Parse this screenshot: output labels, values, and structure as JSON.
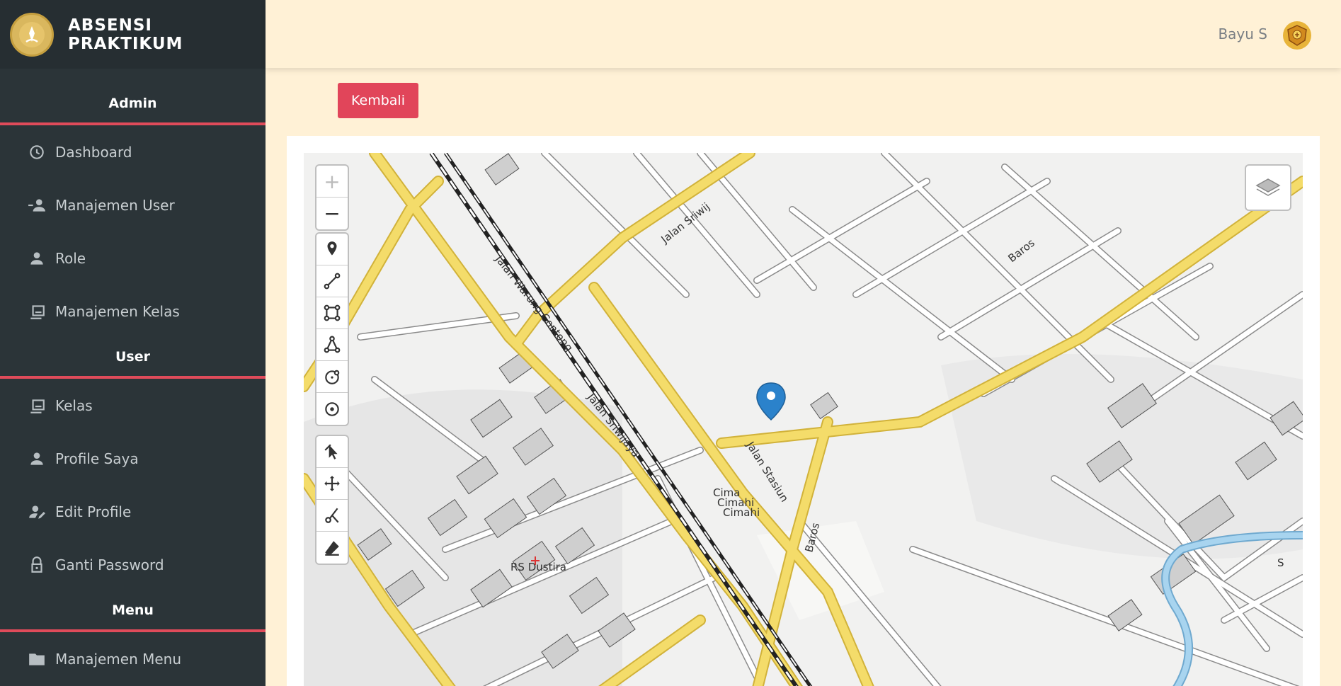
{
  "brand": {
    "line1": "ABSENSI",
    "line2": "PRAKTIKUM"
  },
  "sidebar": {
    "sections": [
      {
        "title": "Admin",
        "items": [
          {
            "label": "Dashboard",
            "icon": "dashboard-icon"
          },
          {
            "label": "Manajemen User",
            "icon": "users-icon"
          },
          {
            "label": "Role",
            "icon": "person-icon"
          },
          {
            "label": "Manajemen Kelas",
            "icon": "class-icon"
          }
        ]
      },
      {
        "title": "User",
        "items": [
          {
            "label": "Kelas",
            "icon": "class-icon"
          },
          {
            "label": "Profile Saya",
            "icon": "person-icon"
          },
          {
            "label": "Edit Profile",
            "icon": "edit-user-icon"
          },
          {
            "label": "Ganti Password",
            "icon": "lock-icon"
          }
        ]
      },
      {
        "title": "Menu",
        "items": [
          {
            "label": "Manajemen Menu",
            "icon": "folder-icon"
          }
        ]
      }
    ]
  },
  "topbar": {
    "user_name": "Bayu S"
  },
  "actions": {
    "back_label": "Kembali"
  },
  "map": {
    "zoom_in": "+",
    "zoom_out": "−",
    "streets": {
      "sriwijaya_top": "Jalan Sriwij",
      "warung_contong": "Jalan Warung Contong",
      "sriwijaya": "Jalan Sriwijaya",
      "stasiun": "Jalan Stasiun",
      "baros_top": "Baros",
      "baros": "Baros",
      "rs_dustira": "RS Dustira",
      "cimahi_1": "Cima",
      "cimahi_2": "Cimahi",
      "cimahi_3": "Cimahi",
      "s_letter": "S"
    },
    "draw_tools": [
      "marker-icon",
      "polyline-icon",
      "rectangle-icon",
      "polygon-icon",
      "circle-icon",
      "circle-marker-icon"
    ],
    "edit_tools": [
      "edit-icon",
      "drag-icon",
      "cut-icon",
      "eraser-icon"
    ],
    "colors": {
      "road": "#f4dc6a",
      "road_edge": "#d1b23a",
      "river": "#a8d4ef",
      "marker": "#2b82cb",
      "accent": "#e1455a"
    }
  }
}
